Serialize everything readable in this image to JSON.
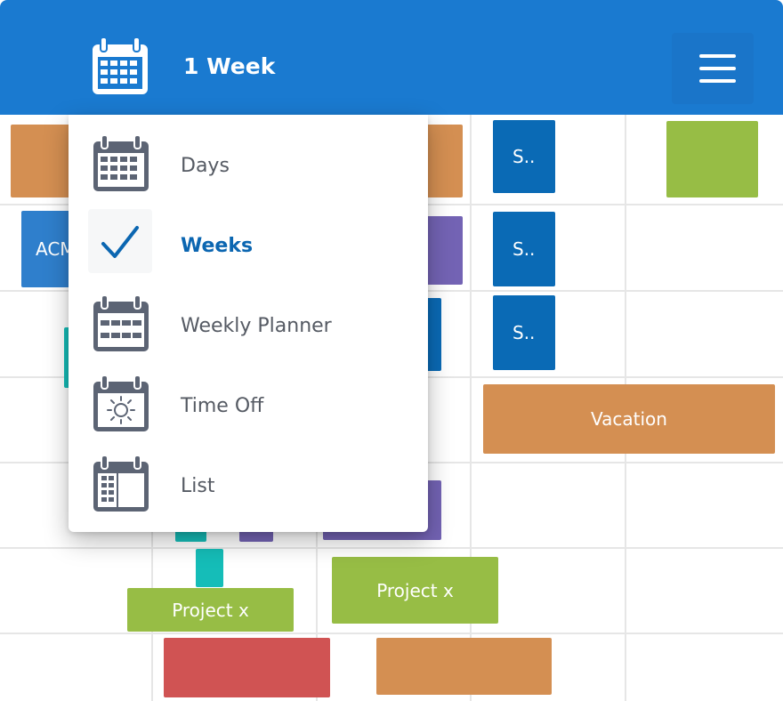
{
  "header": {
    "title": "1 Week",
    "calendar_icon": "calendar-icon",
    "menu_icon": "hamburger-menu-icon"
  },
  "dropdown": {
    "items": [
      {
        "label": "Days",
        "icon": "calendar-days-icon",
        "selected": false
      },
      {
        "label": "Weeks",
        "icon": "checkmark-icon",
        "selected": true
      },
      {
        "label": "Weekly Planner",
        "icon": "calendar-weekly-planner-icon",
        "selected": false
      },
      {
        "label": "Time Off",
        "icon": "calendar-sun-icon",
        "selected": false
      },
      {
        "label": "List",
        "icon": "calendar-list-icon",
        "selected": false
      }
    ]
  },
  "events": {
    "acme": "ACM",
    "s1": "S..",
    "s2": "S..",
    "s3": "S..",
    "vacation": "Vacation",
    "project1": "Project x",
    "project2": "Project x"
  },
  "colors": {
    "header": "#1a7ad0",
    "accent": "#0b66b1",
    "orange": "#d48f52",
    "blue": "#0a6ab5",
    "purple": "#7363b4",
    "green": "#97bd45",
    "teal": "#15bdb8",
    "red": "#d05353"
  }
}
